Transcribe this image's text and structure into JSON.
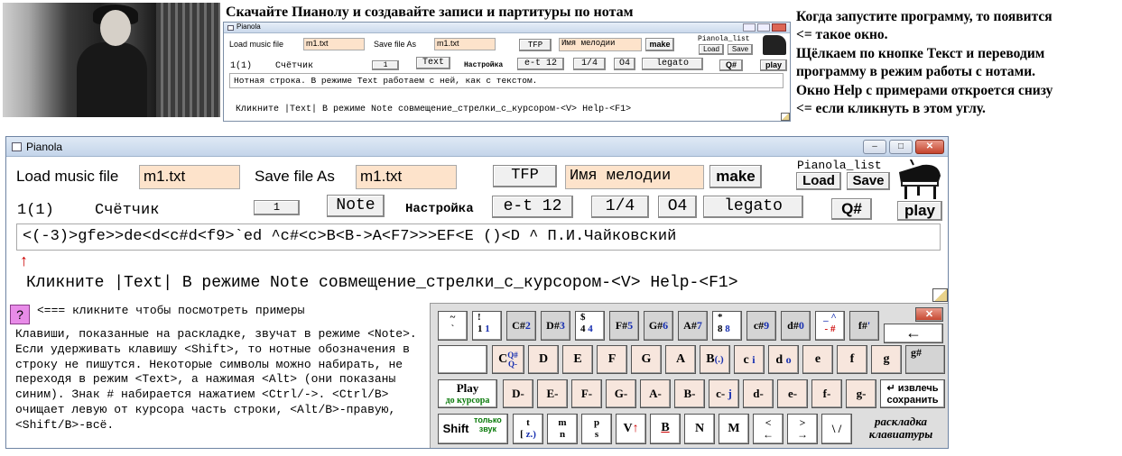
{
  "heading": "Скачайте Пианолу и создавайте записи и партитуры по нотам",
  "side_note": [
    "Когда запустите программу, то появится",
    "<= такое окно.",
    "Щёлкаем по кнопке Текст и переводим",
    "программу в режим работы с нотами.",
    "Окно Help с примерами откроется снизу",
    "<= если кликнуть в этом углу."
  ],
  "thumb": {
    "title": "Pianola",
    "load_label": "Load music file",
    "load_value": "m1.txt",
    "save_label": "Save file As",
    "save_value": "m1.txt",
    "tfp": "TFP",
    "melody": "Имя мелодии",
    "make": "make",
    "pianola_list": "Pianola_list",
    "load_btn": "Load",
    "save_btn": "Save",
    "counter_label": "1(1)",
    "counter_word": "Счётчик",
    "counter_btn": "1",
    "mode_btn": "Text",
    "settings": "Настройка",
    "temper": "e-t 12",
    "dur": "1/4",
    "oct": "O4",
    "legato": "legato",
    "qsharp": "Q#",
    "play": "play",
    "line": "Нотная строка. В режиме Text работаем с ней, как с текстом.",
    "hint": "Кликните |Text|   В режиме Note совмещение_стрелки_с_курсором-<V>   Help-<F1>"
  },
  "window": {
    "title": "Pianola",
    "controls": {
      "min": "–",
      "max": "□",
      "close": "✕"
    },
    "load_label": "Load music file",
    "load_value": "m1.txt",
    "save_label": "Save file As",
    "save_value": "m1.txt",
    "tfp": "TFP",
    "melody": "Имя мелодии",
    "make": "make",
    "pianola_list": "Pianola_list",
    "load_btn": "Load",
    "save_btn": "Save",
    "counter_label": "1(1)",
    "counter_word": "Счётчик",
    "counter_btn": "1",
    "mode_btn": "Note",
    "settings": "Настройка",
    "temper": "e-t 12",
    "dur": "1/4",
    "oct": "O4",
    "legato": "legato",
    "qsharp": "Q#",
    "play": "play",
    "note_line": "<(-3)>gfe>>de<d<c#d<f9>`ed   ^c#<c>B<B->A<F7>>>EF<E   ()<D ^  П.И.Чайковский",
    "cursor_arrow": "↑",
    "hint": "Кликните |Text|   В режиме Note совмещение_стрелки_с_курсором-<V>   Help-<F1>",
    "help_q": "?",
    "help_hint": "<=== кликните чтобы посмотреть примеры",
    "desc": "Клавиши, показанные на раскладке, звучат в режиме <Note>. Если удерживать клавишу <Shift>, то нотные обозначения в строку не пишутся. Некоторые символы можно набирать, не переходя в режим <Text>, а нажимая <Alt> (они показаны синим). Знак # набирается нажатием <Ctrl/->. <Ctrl/B> очищает левую от курсора часть строки, <Alt/B>-правую, <Shift/B>-всё."
  },
  "keyboard": {
    "close": "✕",
    "row1": [
      {
        "top": "~",
        "bot": "`"
      },
      {
        "top": "!",
        "bot": "1",
        "blue": "1"
      },
      {
        "note": "C#",
        "blue": "2"
      },
      {
        "note": "D#",
        "blue": "3"
      },
      {
        "top": "$",
        "bot": "4",
        "blue": "4"
      },
      {
        "note": "F#",
        "blue": "5"
      },
      {
        "note": "G#",
        "blue": "6"
      },
      {
        "note": "A#",
        "blue": "7"
      },
      {
        "top": "*",
        "bot": "8",
        "blue": "8"
      },
      {
        "note": "c#",
        "blue": "9"
      },
      {
        "note": "d#",
        "blue": "0"
      },
      {
        "top": "_ ^",
        "bot": "- #"
      },
      {
        "note": "f#",
        "blue": "'"
      },
      {
        "top": "←",
        "bot": ""
      }
    ],
    "row2": [
      {
        "note": "C",
        "blue": "Q#",
        "sub": "Q-"
      },
      {
        "note": "D"
      },
      {
        "note": "E"
      },
      {
        "note": "F"
      },
      {
        "note": "G"
      },
      {
        "note": "A"
      },
      {
        "note": "B",
        "blue": "(.)"
      },
      {
        "note": "c",
        "blue": "i"
      },
      {
        "note": "d",
        "blue": "o"
      },
      {
        "note": "e"
      },
      {
        "note": "f"
      },
      {
        "note": "g"
      },
      {
        "note": "g#"
      }
    ],
    "row3_play": "Play",
    "row3_play_sub": "до курсора",
    "row3": [
      "D-",
      "E-",
      "F-",
      "G-",
      "A-",
      "B-",
      "c-",
      "d-",
      "e-",
      "f-",
      "g-"
    ],
    "row3_blue": {
      "c-": "j"
    },
    "enter_label": "↵ извлечь",
    "enter_sub": "сохранить",
    "shift": "Shift",
    "shift_sub": "только звук",
    "row4": [
      {
        "top": "t",
        "bot": "[",
        "blue": "z.)"
      },
      {
        "top": "m",
        "bot": "n"
      },
      {
        "top": "p",
        "bot": "s"
      },
      {
        "note": "V",
        "red": "↑"
      },
      {
        "note": "B"
      },
      {
        "note": "N"
      },
      {
        "note": "M"
      },
      {
        "top": "<",
        "bot": "←"
      },
      {
        "top": ">",
        "bot": "→"
      },
      {
        "note": "\\ /"
      }
    ],
    "layout_label_1": "раскладка",
    "layout_label_2": "клавиатуры"
  }
}
